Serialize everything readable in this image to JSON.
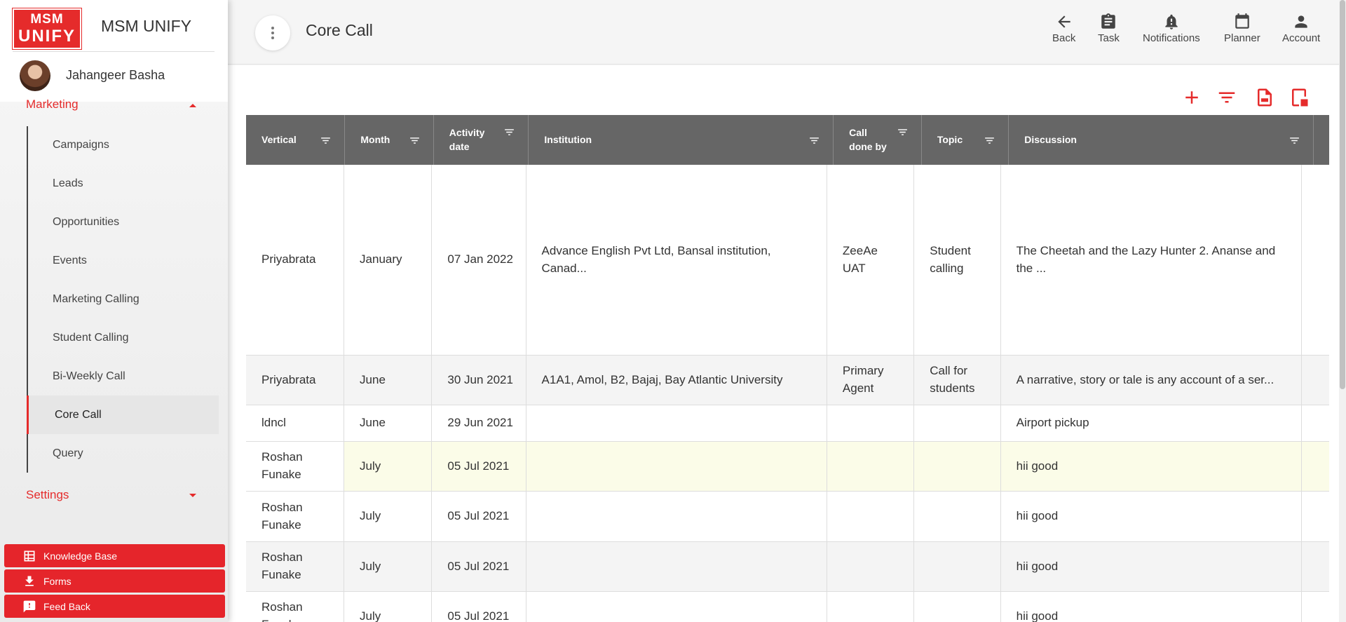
{
  "app": {
    "brand_line1": "MSM",
    "brand_line2": "UNIFY",
    "brand_name": "MSM UNIFY"
  },
  "user": {
    "name": "Jahangeer Basha"
  },
  "sidebar": {
    "section_marketing": "Marketing",
    "section_settings": "Settings",
    "items": [
      {
        "label": "Campaigns"
      },
      {
        "label": "Leads"
      },
      {
        "label": "Opportunities"
      },
      {
        "label": "Events"
      },
      {
        "label": "Marketing Calling"
      },
      {
        "label": "Student Calling"
      },
      {
        "label": "Bi-Weekly Call"
      },
      {
        "label": "Core Call"
      },
      {
        "label": "Query"
      }
    ],
    "active_item": "Core Call",
    "quick_buttons": [
      {
        "label": "Knowledge Base",
        "icon": "table-icon"
      },
      {
        "label": "Forms",
        "icon": "download-icon"
      },
      {
        "label": "Feed Back",
        "icon": "feedback-icon"
      }
    ]
  },
  "header": {
    "title": "Core Call",
    "actions": [
      {
        "label": "Back",
        "icon": "arrow-left-icon"
      },
      {
        "label": "Task",
        "icon": "clipboard-icon"
      },
      {
        "label": "Notifications",
        "icon": "bell-icon"
      },
      {
        "label": "Planner",
        "icon": "calendar-icon"
      },
      {
        "label": "Account",
        "icon": "person-icon"
      }
    ]
  },
  "toolbar": {
    "icons": [
      "add-icon",
      "filter-icon",
      "export-csv-icon",
      "column-settings-icon"
    ],
    "accent": "#e52b2b"
  },
  "table": {
    "columns": [
      "Vertical",
      "Month",
      "Activity date",
      "Institution",
      "Call done by",
      "Topic",
      "Discussion"
    ],
    "rows": [
      {
        "vertical": "Priyabrata",
        "month": "January",
        "activity_date": "07 Jan 2022",
        "institution": "Advance English Pvt Ltd, Bansal institution, Canad...",
        "call_done_by": "ZeeAe UAT",
        "topic": "Student calling",
        "discussion": "The Cheetah and the Lazy Hunter 2. Ananse and the ..."
      },
      {
        "vertical": "Priyabrata",
        "month": "June",
        "activity_date": "30 Jun 2021",
        "institution": "A1A1, Amol, B2, Bajaj, Bay Atlantic University",
        "call_done_by": "Primary Agent",
        "topic": "Call for students",
        "discussion": "A narrative, story or tale is any account of a ser..."
      },
      {
        "vertical": "ldncl",
        "month": "June",
        "activity_date": "29 Jun 2021",
        "institution": "",
        "call_done_by": "",
        "topic": "",
        "discussion": "Airport pickup"
      },
      {
        "vertical": "Roshan Funake",
        "month": "July",
        "activity_date": "05 Jul 2021",
        "institution": "",
        "call_done_by": "",
        "topic": "",
        "discussion": "hii good"
      },
      {
        "vertical": "Roshan Funake",
        "month": "July",
        "activity_date": "05 Jul 2021",
        "institution": "",
        "call_done_by": "",
        "topic": "",
        "discussion": "hii good"
      },
      {
        "vertical": "Roshan Funake",
        "month": "July",
        "activity_date": "05 Jul 2021",
        "institution": "",
        "call_done_by": "",
        "topic": "",
        "discussion": "hii good"
      },
      {
        "vertical": "Roshan Funake",
        "month": "July",
        "activity_date": "05 Jul 2021",
        "institution": "",
        "call_done_by": "",
        "topic": "",
        "discussion": "hii good"
      }
    ]
  },
  "colors": {
    "accent": "#e52b2b",
    "header_bg": "#666666",
    "highlight_row": "#fbfce8"
  }
}
